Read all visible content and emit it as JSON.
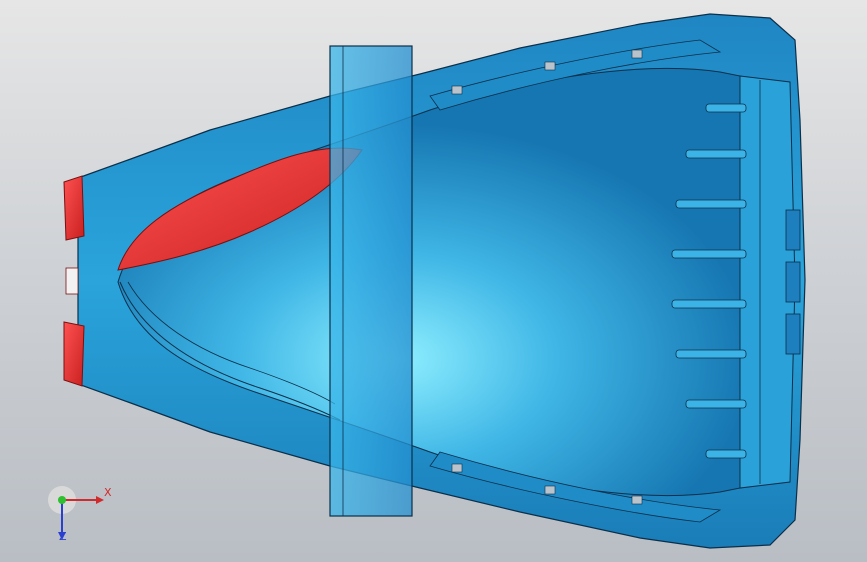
{
  "viewport": {
    "background_top": "#e6e6e6",
    "background_bottom": "#b9bec4"
  },
  "model": {
    "body_color": "#2f9ed6",
    "highlight_color": "#86e6ff",
    "section_color": "#e53030",
    "line_color": "#0c2f4a"
  },
  "triad": {
    "x_label": "X",
    "z_label": "Z",
    "x_color": "#d12a2a",
    "y_color": "#2fbf2f",
    "z_color": "#2b3fcf"
  }
}
